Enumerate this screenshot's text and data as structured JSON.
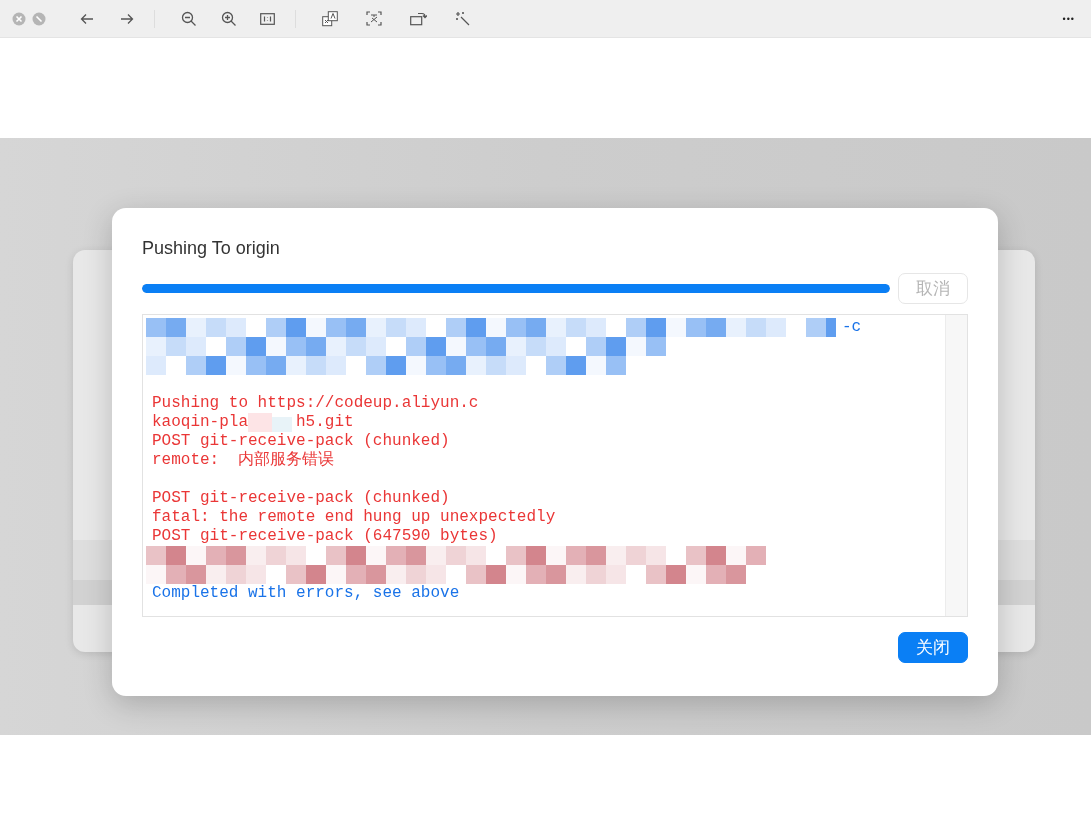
{
  "toolbar": {
    "more": "•••"
  },
  "dialog": {
    "title": "Pushing To origin",
    "progress": {
      "level": 1.0
    },
    "cancel_button": {
      "label": "取消",
      "disabled": true
    },
    "log_lines": [
      {
        "kind": "masked",
        "color": "#1a73e8",
        "tail": "-c"
      },
      {
        "kind": "masked"
      },
      {
        "kind": "masked"
      },
      {
        "kind": "blank"
      },
      {
        "kind": "text",
        "color": "#ea3636",
        "text": "Pushing to https://codeup.aliyun.c"
      },
      {
        "kind": "split",
        "color": "#ea3636",
        "text": "kaoqin-pla",
        "tail": "h5.git"
      },
      {
        "kind": "text",
        "color": "#ea3636",
        "text": "POST git-receive-pack (chunked)"
      },
      {
        "kind": "text",
        "color": "#ea3636",
        "text": "remote:  内部服务错误"
      },
      {
        "kind": "blank"
      },
      {
        "kind": "text",
        "color": "#ea3636",
        "text": "POST git-receive-pack (chunked)"
      },
      {
        "kind": "text",
        "color": "#ea3636",
        "text": "fatal: the remote end hung up unexpectedly"
      },
      {
        "kind": "text",
        "color": "#ea3636",
        "text": "POST git-receive-pack (647590 bytes)"
      },
      {
        "kind": "masked"
      },
      {
        "kind": "masked"
      },
      {
        "kind": "text",
        "color": "#1a73e8",
        "text": "Completed with errors, see above"
      }
    ],
    "close_button": {
      "label": "关闭",
      "primary": true
    }
  }
}
